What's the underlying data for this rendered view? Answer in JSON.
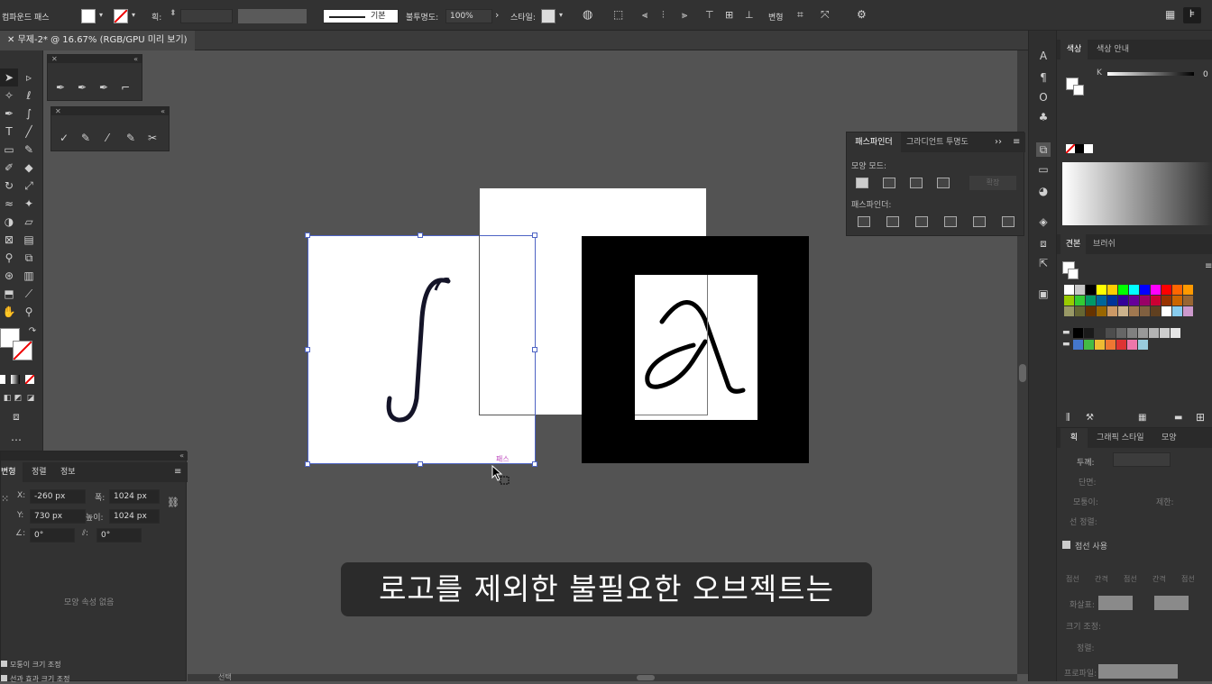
{
  "control_bar": {
    "object_type": "컴파운드 패스",
    "stroke_label": "획:",
    "brush_label": "기본",
    "opacity_label": "불투명도:",
    "opacity_value": "100%",
    "style_label": "스타일:",
    "transform_label": "변형"
  },
  "document_tab": {
    "title": "무제-2* @ 16.67% (RGB/GPU 미리 보기)"
  },
  "pathfinder": {
    "tabs": [
      "패스파인더",
      "그라디언트",
      "투명도"
    ],
    "shape_modes_label": "모양 모드:",
    "expand_label": "확장",
    "pathfinders_label": "패스파인더:"
  },
  "transform_panel": {
    "tabs": [
      "변형",
      "정렬",
      "정보"
    ],
    "x_label": "X:",
    "x_value": "-260 px",
    "y_label": "Y:",
    "y_value": "730 px",
    "w_label": "폭:",
    "w_value": "1024 px",
    "h_label": "높이:",
    "h_value": "1024 px",
    "angle_value": "0°",
    "shear_value": "0°",
    "shape_props_label": "모양 속성 없음",
    "scale_corners_label": "모퉁이 크기 조정",
    "scale_strokes_label": "선과 효과 크기 조정"
  },
  "color_panel": {
    "tabs": [
      "색상",
      "색상 안내"
    ],
    "k_label": "K",
    "k_value": "0"
  },
  "swatches_panel": {
    "tabs": [
      "견본",
      "브러쉬"
    ]
  },
  "stroke_panel": {
    "tabs": [
      "획",
      "그래픽 스타일",
      "모양"
    ],
    "weight_label": "두께:",
    "cap_label": "단면:",
    "corner_label": "모퉁이:",
    "limit_label": "제한:",
    "align_label": "선 정렬:",
    "dashed_label": "점선 사용",
    "dash_labels": [
      "점선",
      "간격",
      "점선",
      "간격",
      "점선"
    ],
    "arrow_label": "화살표:",
    "scale_label": "크기 조정:",
    "align2_label": "정렬:",
    "profile_label": "프로파일:"
  },
  "canvas": {
    "path_hint": "패스",
    "status_label": "선택"
  },
  "subtitle": "로고를 제외한 불필요한 오브젝트는",
  "swatch_colors": [
    [
      "#ffffff",
      "#c8c8c8",
      "#000000",
      "#ffff00",
      "#ffcc00",
      "#00ff00",
      "#00ffff",
      "#0000ff",
      "#ff00ff",
      "#ff0000",
      "#ff6600",
      "#ff9900"
    ],
    [
      "#99cc00",
      "#33cc33",
      "#009966",
      "#006699",
      "#003399",
      "#330099",
      "#660099",
      "#990066",
      "#cc0033",
      "#993300",
      "#cc6600",
      "#996633"
    ],
    [
      "#999966",
      "#666633",
      "#663300",
      "#996600",
      "#cc9966",
      "#ccb38c",
      "#a07850",
      "#806040",
      "#604020",
      "#ffffff",
      "#88ccee",
      "#cc99cc"
    ]
  ],
  "gray_swatches": [
    "#000000",
    "#1a1a1a",
    "#333333",
    "#4d4d4d",
    "#666666",
    "#808080",
    "#999999",
    "#b3b3b3",
    "#cccccc",
    "#e6e6e6"
  ],
  "color_swatches2": [
    "#4477cc",
    "#44bb44",
    "#eebb33",
    "#ee7733",
    "#dd3333",
    "#ee77aa",
    "#99ccdd"
  ]
}
